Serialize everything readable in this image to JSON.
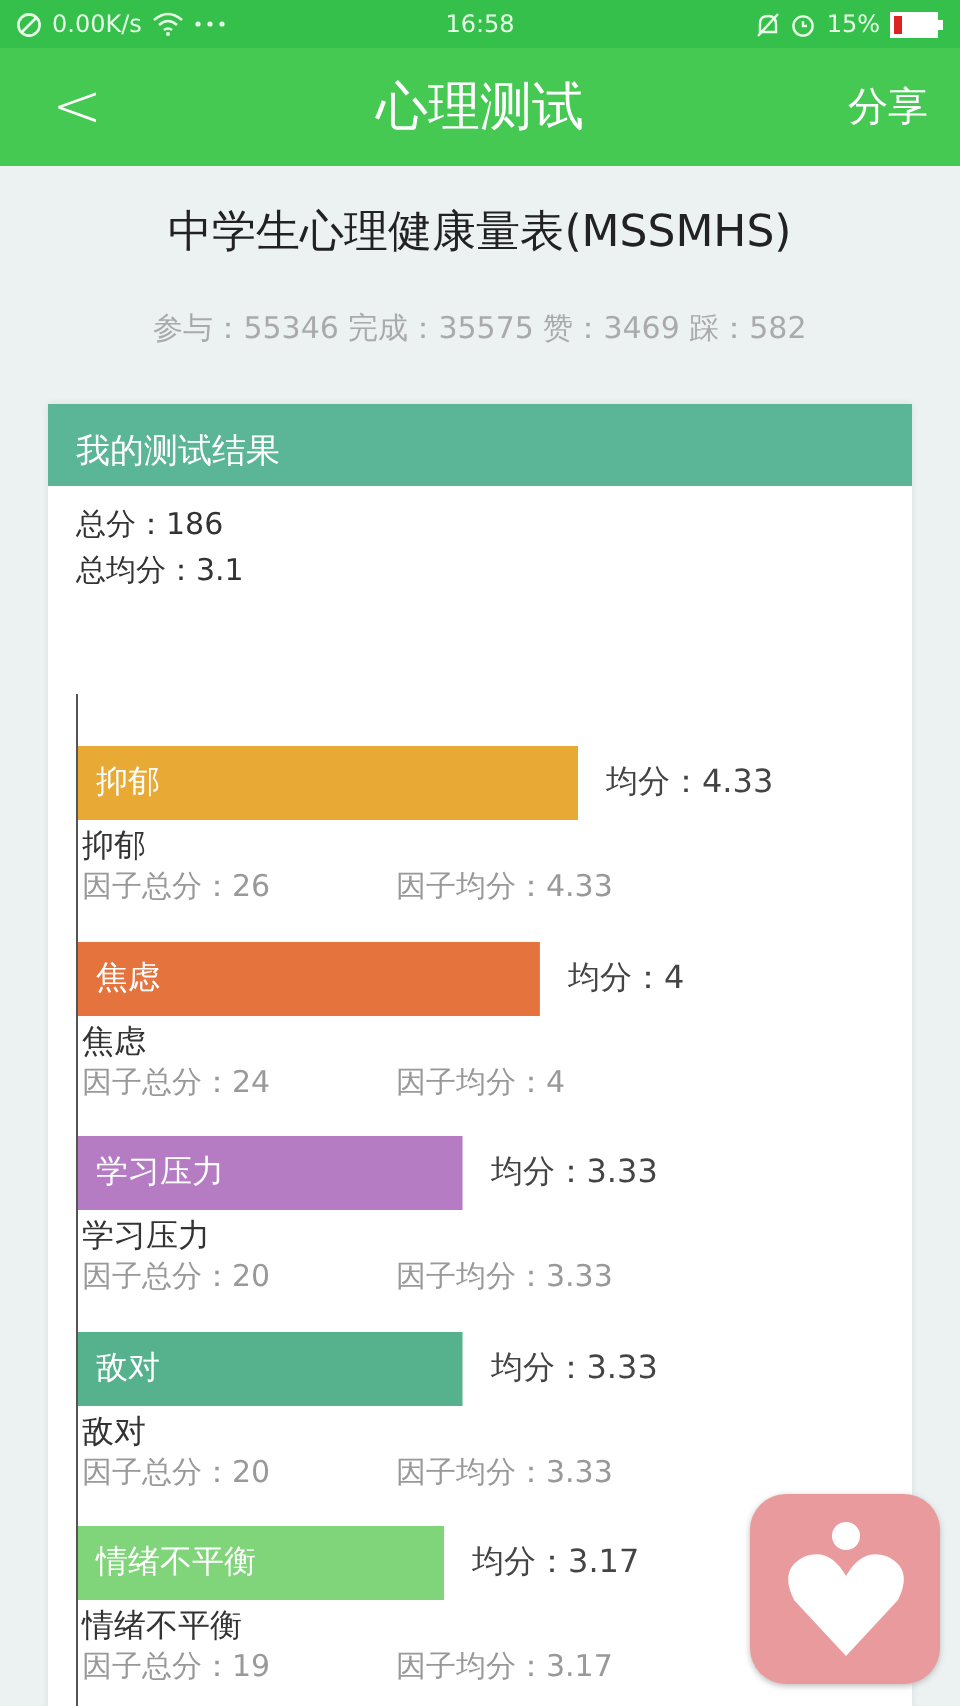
{
  "status_bar": {
    "speed": "0.00K/s",
    "time": "16:58",
    "battery": "15%"
  },
  "header": {
    "back": "<",
    "title": "心理测试",
    "share": "分享"
  },
  "test": {
    "title": "中学生心理健康量表(MSSMHS)",
    "stats": "参与：55346 完成：35575 赞：3469 踩：582"
  },
  "result": {
    "title": "我的测试结果",
    "total": "总分：186",
    "average": "总均分：3.1",
    "chart_data": {
      "type": "bar",
      "orientation": "horizontal",
      "categories": [
        "抑郁",
        "焦虑",
        "学习压力",
        "敌对",
        "情绪不平衡"
      ],
      "values": [
        4.33,
        4,
        3.33,
        3.33,
        3.17
      ],
      "value_labels": [
        "均分：4.33",
        "均分：4",
        "均分：3.33",
        "均分：3.33",
        "均分：3.17"
      ]
    }
  },
  "factors": [
    {
      "name": "抑郁",
      "total": "因子总分：26",
      "factor_avg": "因子均分：4.33",
      "color": "#e8a935"
    },
    {
      "name": "焦虑",
      "total": "因子总分：24",
      "factor_avg": "因子均分：4",
      "color": "#e5733d"
    },
    {
      "name": "学习压力",
      "total": "因子总分：20",
      "factor_avg": "因子均分：3.33",
      "color": "#b57cc4"
    },
    {
      "name": "敌对",
      "total": "因子总分：20",
      "factor_avg": "因子均分：3.33",
      "color": "#55b28d"
    },
    {
      "name": "情绪不平衡",
      "total": "因子总分：19",
      "factor_avg": "因子均分：3.17",
      "color": "#80d57a"
    }
  ]
}
